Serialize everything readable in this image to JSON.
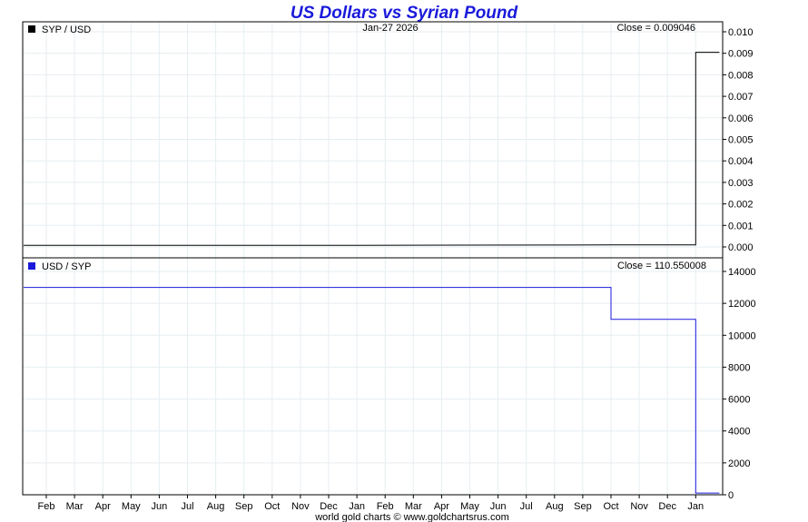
{
  "title": "US Dollars vs Syrian Pound",
  "date_label": "Jan-27  2026",
  "footer": "world gold charts © www.goldchartsrus.com",
  "colors": {
    "title": "#1a1adc",
    "series_top": "#000000",
    "series_bottom": "#1a1adc",
    "grid": "#e6eef2"
  },
  "months": [
    "Feb",
    "Mar",
    "Apr",
    "May",
    "Jun",
    "Jul",
    "Aug",
    "Sep",
    "Oct",
    "Nov",
    "Dec",
    "Jan",
    "Feb",
    "Mar",
    "Apr",
    "May",
    "Jun",
    "Jul",
    "Aug",
    "Sep",
    "Oct",
    "Nov",
    "Dec",
    "Jan"
  ],
  "chart_data": [
    {
      "type": "line",
      "legend": "SYP / USD",
      "close_label": "Close = 0.009046",
      "ylim": [
        0,
        0.01
      ],
      "yticks": [
        "0.000",
        "0.001",
        "0.002",
        "0.003",
        "0.004",
        "0.005",
        "0.006",
        "0.007",
        "0.008",
        "0.009",
        "0.010"
      ],
      "grid": true,
      "series": [
        {
          "x": [
            "Jan 2024",
            "Jan 2025",
            "Oct 2025",
            "Jan 2026",
            "Jan 2026",
            "Jan-27 2026"
          ],
          "values": [
            7.7e-05,
            7.7e-05,
            9.1e-05,
            9.1e-05,
            0.009046,
            0.009046
          ]
        }
      ]
    },
    {
      "type": "line",
      "legend": "USD / SYP",
      "close_label": "Close = 110.550008",
      "ylim": [
        0,
        14000
      ],
      "yticks": [
        "0",
        "2000",
        "4000",
        "6000",
        "8000",
        "10000",
        "12000",
        "14000"
      ],
      "grid": true,
      "series": [
        {
          "x": [
            "Jan 2024",
            "Oct 2025",
            "Oct 2025",
            "Jan 2026",
            "Jan 2026",
            "Jan-27 2026"
          ],
          "values": [
            13000,
            13000,
            11000,
            11000,
            110.55,
            110.55
          ]
        }
      ]
    }
  ]
}
